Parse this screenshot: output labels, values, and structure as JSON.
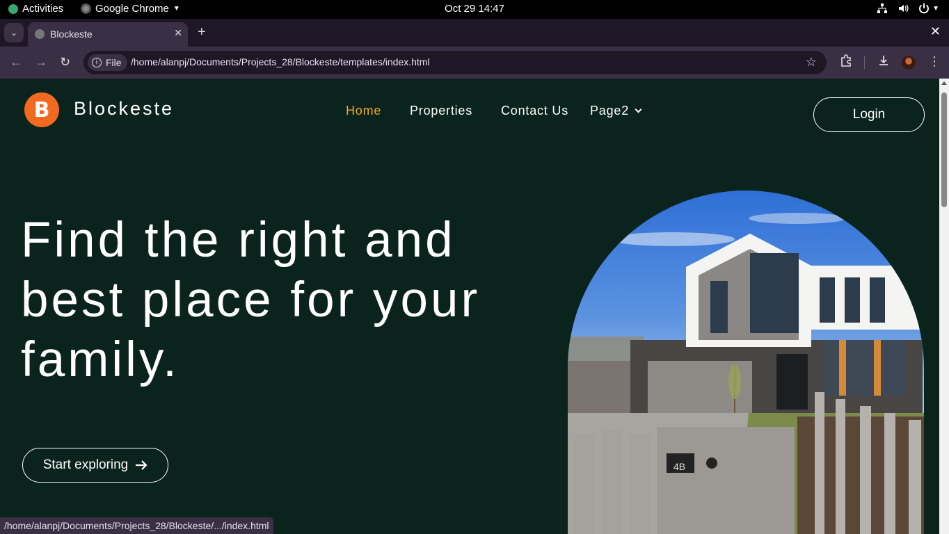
{
  "topbar": {
    "activities": "Activities",
    "app_name": "Google Chrome",
    "clock": "Oct 29  14:47"
  },
  "tabs": [
    {
      "title": "Blockeste"
    }
  ],
  "toolbar": {
    "chip_label": "File",
    "url": "/home/alanpj/Documents/Projects_28/Blockeste/templates/index.html"
  },
  "site": {
    "logo_letter": "B",
    "brand": "Blockeste",
    "nav": [
      {
        "label": "Home"
      },
      {
        "label": "Properties"
      },
      {
        "label": "Contact Us"
      },
      {
        "label": "Page2"
      }
    ],
    "login_label": "Login",
    "hero_lines": [
      "Find the right and",
      "best place for your",
      "family."
    ],
    "explore_label": "Start exploring",
    "house_number": "4B"
  },
  "status_url": "/home/alanpj/Documents/Projects_28/Blockeste/.../index.html",
  "colors": {
    "page_bg": "#0a231c",
    "accent": "#f5a623",
    "logo": "#f26a1f"
  },
  "icons": [
    "gnome-activities-icon",
    "chrome-icon",
    "network-icon",
    "volume-icon",
    "power-icon",
    "back-icon",
    "forward-icon",
    "reload-icon",
    "info-icon",
    "star-icon",
    "extensions-icon",
    "download-icon",
    "arrow-right-icon",
    "chevron-down-icon"
  ]
}
